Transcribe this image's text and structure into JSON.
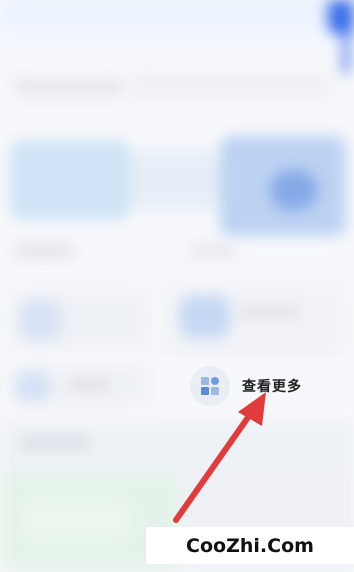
{
  "more_entry": {
    "label": "查看更多",
    "icon": "grid-apps-icon"
  },
  "annotation": {
    "arrow_color": "#e23b3b",
    "arrow_icon": "red-arrow-pointer"
  },
  "watermark": {
    "text": "CooZhi.Com"
  }
}
